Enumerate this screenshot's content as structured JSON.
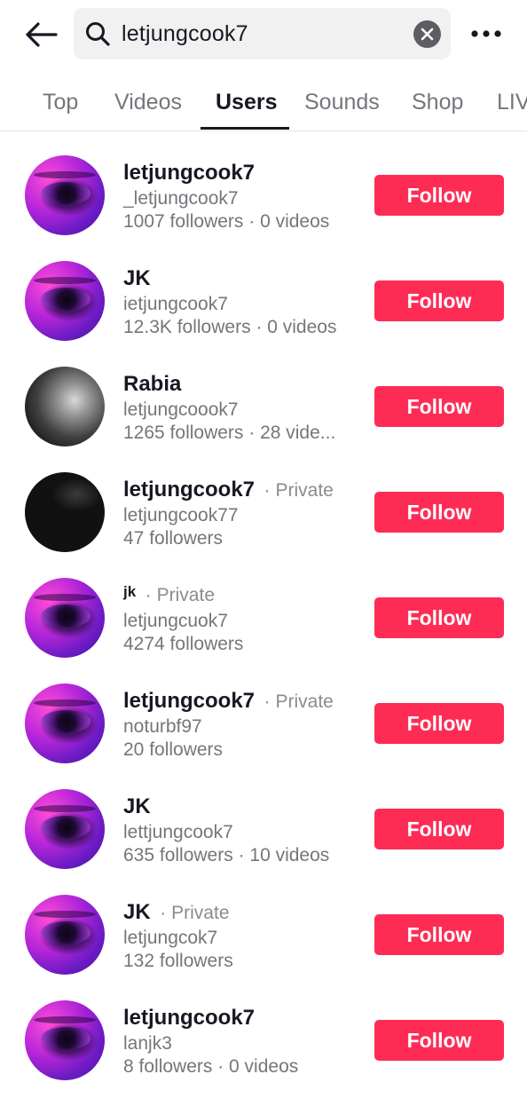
{
  "search": {
    "query": "letjungcook7"
  },
  "tabs": [
    {
      "label": "Top"
    },
    {
      "label": "Videos"
    },
    {
      "label": "Users"
    },
    {
      "label": "Sounds"
    },
    {
      "label": "Shop"
    },
    {
      "label": "LIV"
    }
  ],
  "active_tab": "Users",
  "colors": {
    "follow_button": "#fe2c55",
    "text_primary": "#161823",
    "text_secondary": "#75767c"
  },
  "users": [
    {
      "name": "letjungcook7",
      "private": "",
      "handle": "_letjungcook7",
      "stats": "1007 followers · 0 videos",
      "follow_label": "Follow"
    },
    {
      "name": "JK",
      "private": "",
      "handle": "ietjungcook7",
      "stats": "12.3K followers · 0 videos",
      "follow_label": "Follow"
    },
    {
      "name": "Rabia",
      "private": "",
      "handle": "letjungcoook7",
      "stats": "1265 followers · 28 vide...",
      "follow_label": "Follow"
    },
    {
      "name": "letjungcook7",
      "private": "Private",
      "handle": "letjungcook77",
      "stats": "47 followers",
      "follow_label": "Follow"
    },
    {
      "name": "jk",
      "private": "Private",
      "handle": "letjungcuok7",
      "stats": "4274 followers",
      "follow_label": "Follow"
    },
    {
      "name": "letjungcook7",
      "private": "Private",
      "handle": "noturbf97",
      "stats": "20 followers",
      "follow_label": "Follow"
    },
    {
      "name": "JK",
      "private": "",
      "handle": "lettjungcook7",
      "stats": "635 followers · 10 videos",
      "follow_label": "Follow"
    },
    {
      "name": "JK",
      "private": "Private",
      "handle": "letjungcok7",
      "stats": "132 followers",
      "follow_label": "Follow"
    },
    {
      "name": "letjungcook7",
      "private": "",
      "handle": "lanjk3",
      "stats": "8 followers · 0 videos",
      "follow_label": "Follow"
    }
  ],
  "private_separator": "·"
}
